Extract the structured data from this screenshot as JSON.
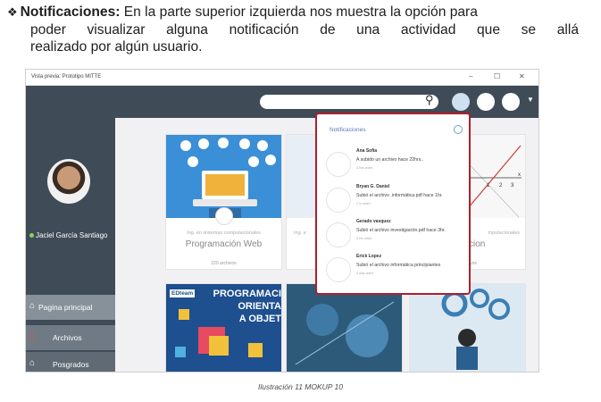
{
  "paragraph": {
    "bullet": "❖",
    "heading": "Notificaciones:",
    "line1_rest": "En la parte superior izquierda nos muestra la opción para",
    "line2": "poder visualizar alguna notificación de una actividad que se allá",
    "line3": "realizado por algún usuario."
  },
  "window": {
    "title": "Vista previa: Prototipo MITTE",
    "controls": [
      "–",
      "☐",
      "✕"
    ]
  },
  "user": {
    "name": "Jaciel García Santiago"
  },
  "nav": [
    {
      "label": "Pagina principal",
      "icon": "home-icon",
      "glyph": "⌂"
    },
    {
      "label": "Archivos",
      "icon": "file-icon",
      "glyph": "▯"
    },
    {
      "label": "Posgrados",
      "icon": "graduation-cap-icon",
      "glyph": "⌂"
    }
  ],
  "cards": [
    {
      "subtitle": "Ing. en sistemas computacionales",
      "title": "Programación Web",
      "count": "220 archivos"
    },
    {
      "subtitle": "Ing. e",
      "title": "",
      "count": ""
    },
    {
      "subtitle": "mputacionales",
      "title": "cion",
      "count": "ivos"
    }
  ],
  "bottom_cards": [
    {
      "brand": "EDteam",
      "text_lines": [
        "PROGRAMACI",
        "ORIENTA",
        "A OBJET"
      ]
    }
  ],
  "chart_axes": {
    "ticks": [
      "1",
      "2",
      "3"
    ],
    "axis_label": "x"
  },
  "notifications": {
    "header": "Notificaciones",
    "items": [
      {
        "name": "Ana Sofia",
        "text": "A subido un archivo hace 22hrs..",
        "time": "22hrs antes"
      },
      {
        "name": "Bryan G. Daniel",
        "text": "Subió el archivo .informática.pdf hace 1hr.",
        "time": "1 hr antes"
      },
      {
        "name": "Gerado vasquez",
        "text": "Subió el archivo investigación.pdf hace 3hr.",
        "time": "3 hrs antes"
      },
      {
        "name": "Erick Lopez",
        "text": "Subió el archivo informática principiantes",
        "time": "3 días antes"
      }
    ]
  },
  "caption": "Ilustración 11 MOKUP 10",
  "colors": {
    "sidebar": "#3f4b57",
    "notif_border": "#b01e2c",
    "accent_blue": "#5a7bb0"
  }
}
